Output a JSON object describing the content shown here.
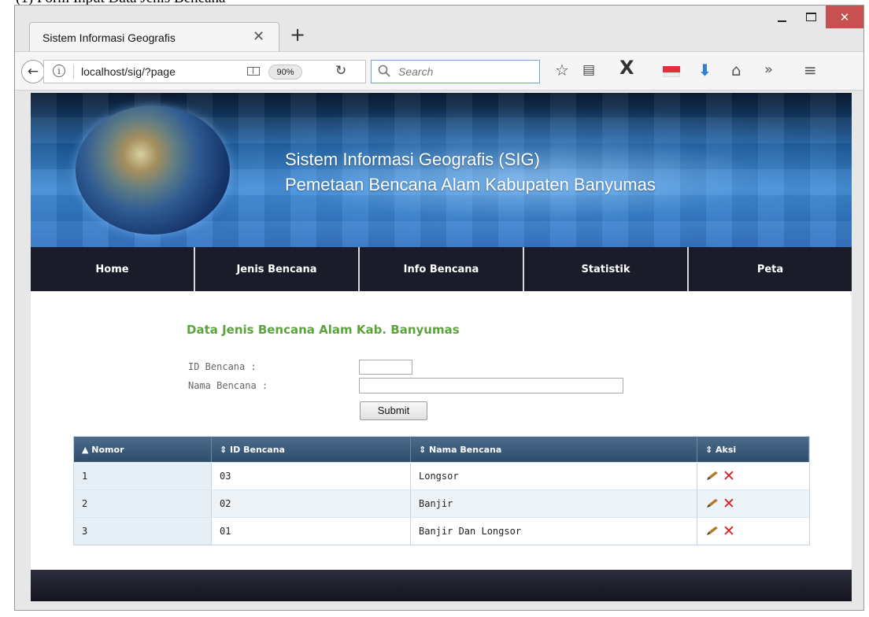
{
  "caption": "(1) Form Input Data Jenis Bencana",
  "browser": {
    "tab_title": "Sistem Informasi Geografis",
    "tab_close": "✕",
    "new_tab": "+",
    "url": "localhost/sig/?page",
    "zoom": "90%",
    "search_placeholder": "Search",
    "controls": {
      "close": "✕"
    },
    "icons": [
      "back-arrow-icon",
      "info-icon",
      "reader-view-icon",
      "reload-icon",
      "search-icon",
      "bookmark-star-icon",
      "bookmarks-library-icon",
      "x-extension-icon",
      "flag-extension-icon",
      "download-icon",
      "home-icon",
      "overflow-icon",
      "menu-icon"
    ]
  },
  "banner": {
    "title": "Sistem Informasi Geografis (SIG)",
    "subtitle": "Pemetaan Bencana Alam Kabupaten Banyumas"
  },
  "menu": {
    "items": [
      {
        "label": "Home"
      },
      {
        "label": "Jenis Bencana"
      },
      {
        "label": "Info Bencana"
      },
      {
        "label": "Statistik"
      },
      {
        "label": "Peta"
      }
    ]
  },
  "form": {
    "title": "Data Jenis Bencana Alam Kab. Banyumas",
    "id_label": "ID Bencana :",
    "name_label": "Nama Bencana :",
    "id_value": "",
    "name_value": "",
    "submit_label": "Submit"
  },
  "table": {
    "headers": [
      "▲ Nomor",
      "⇕ ID Bencana",
      "⇕ Nama Bencana",
      "⇕ Aksi"
    ],
    "rows": [
      {
        "nomor": "1",
        "id": "03",
        "nama": "Longsor"
      },
      {
        "nomor": "2",
        "id": "02",
        "nama": "Banjir"
      },
      {
        "nomor": "3",
        "id": "01",
        "nama": "Banjir Dan Longsor"
      }
    ],
    "action_icons": [
      "edit-pencil-icon",
      "delete-x-icon"
    ],
    "delete_glyph": "✕"
  },
  "colors": {
    "title_green": "#5ba33b",
    "menu_bg": "#1b1c29",
    "header_blue": "#3d5b7a",
    "delete_red": "#d82020",
    "close_button": "#c75050"
  }
}
